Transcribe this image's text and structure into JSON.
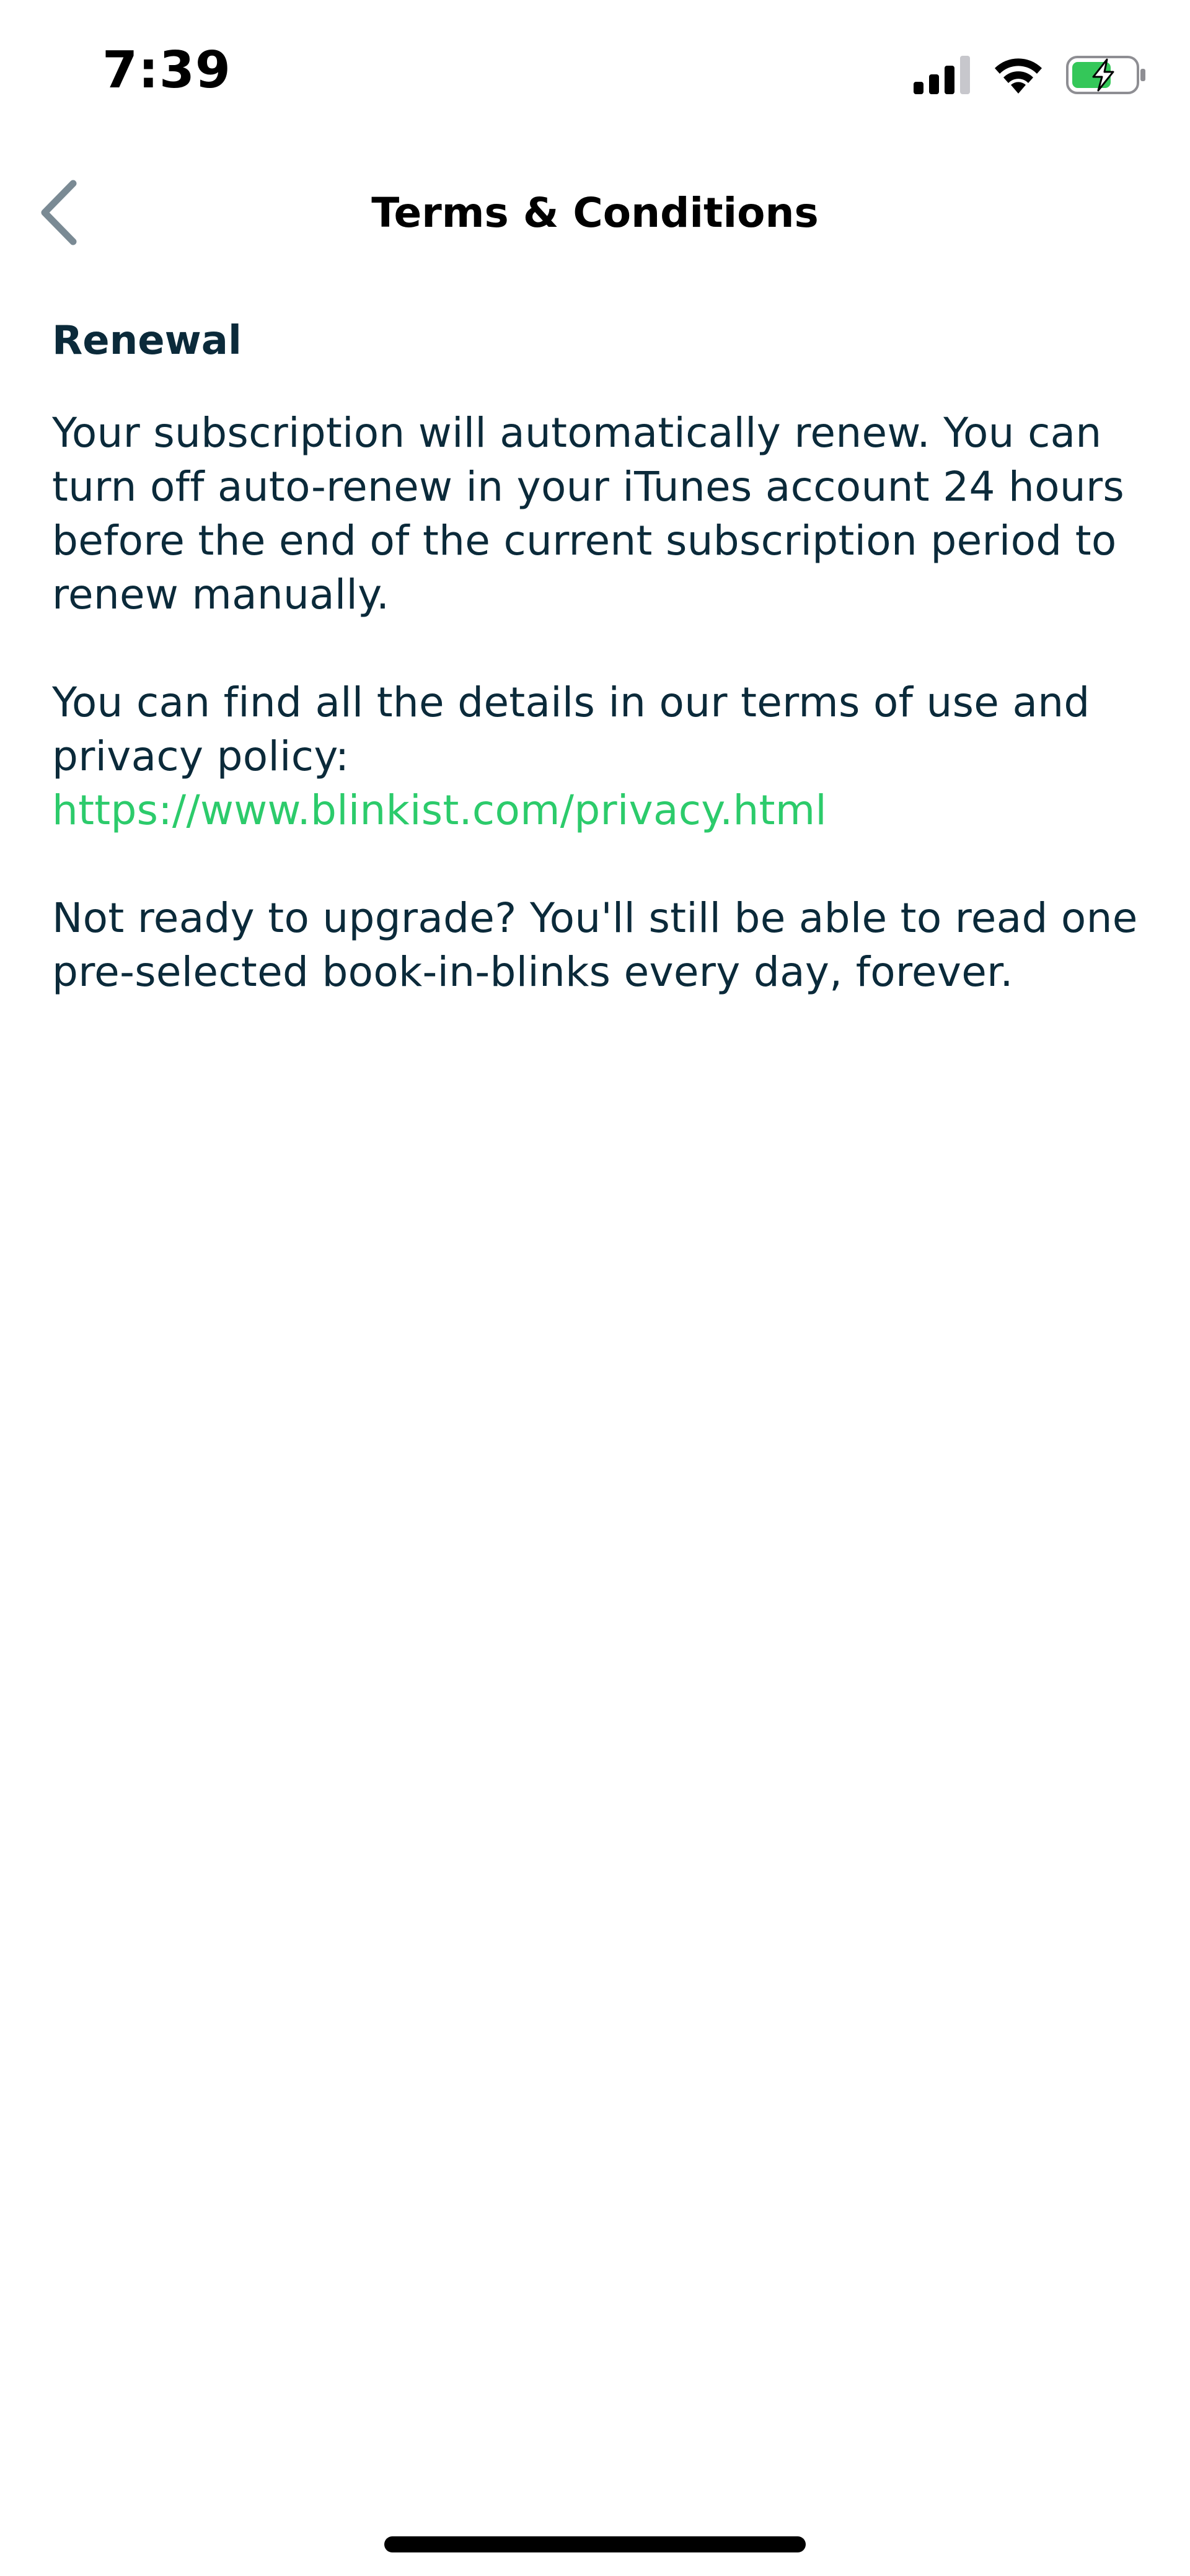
{
  "status_bar": {
    "time": "7:39",
    "icons": [
      "cellular-signal-icon",
      "wifi-icon",
      "battery-charging-icon"
    ],
    "battery_color": "#34c759"
  },
  "header": {
    "title": "Terms & Conditions",
    "back_icon": "chevron-left-icon"
  },
  "content": {
    "heading": "Renewal",
    "paragraph_1": "Your subscription will automatically renew. You can turn off auto-renew in your iTunes account 24 hours before the end of the current subscription period to renew manually.",
    "paragraph_2_text": "You can find all the details in our terms of use and privacy policy:",
    "paragraph_2_link": "https://www.blinkist.com/privacy.html",
    "paragraph_3": "Not ready to upgrade? You'll still be able to read one pre-selected book-in-blinks every day, forever."
  },
  "colors": {
    "text": "#0b2a3a",
    "link": "#2ccb6b",
    "back_icon": "#7a8a94"
  }
}
